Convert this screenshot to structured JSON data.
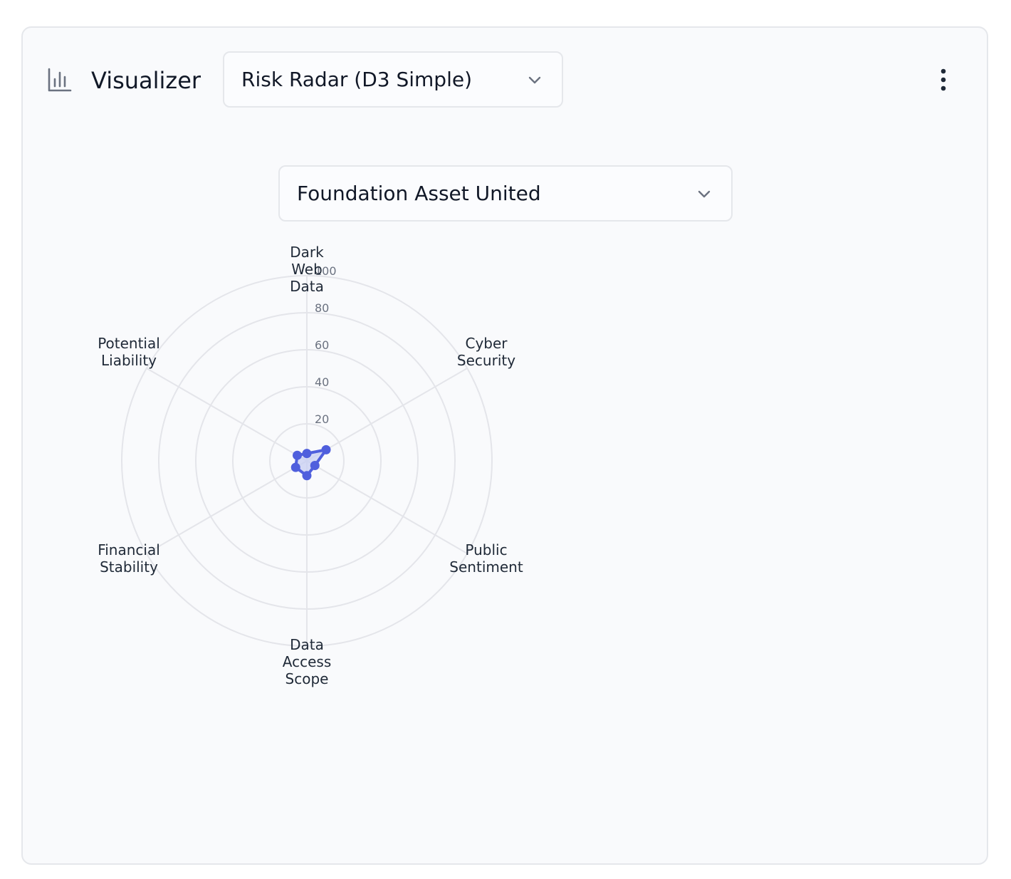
{
  "header": {
    "title": "Visualizer",
    "icon": "bar-chart-icon",
    "visualization_select": {
      "value": "Risk Radar (D3 Simple)"
    },
    "menu_icon": "more-vertical-icon"
  },
  "entity_select": {
    "value": "Foundation Asset United"
  },
  "colors": {
    "accent": "#4f5fdd",
    "fill": "#c7cdf3",
    "grid": "#e4e5ea",
    "axis_label": "#1f2937",
    "tick_label": "#6b7280"
  },
  "chart_data": {
    "type": "radar",
    "axes": [
      "Dark Web Data",
      "Cyber Security",
      "Public Sentiment",
      "Data Access Scope",
      "Financial Stability",
      "Potential Liability"
    ],
    "axis_labels": [
      [
        "Dark",
        "Web",
        "Data"
      ],
      [
        "Cyber",
        "Security"
      ],
      [
        "Public",
        "Sentiment"
      ],
      [
        "Data",
        "Access",
        "Scope"
      ],
      [
        "Financial",
        "Stability"
      ],
      [
        "Potential",
        "Liability"
      ]
    ],
    "values": [
      4,
      12,
      5,
      8,
      7,
      6
    ],
    "range": [
      0,
      100
    ],
    "ticks": [
      20,
      40,
      60,
      80,
      100
    ],
    "grid": true
  }
}
